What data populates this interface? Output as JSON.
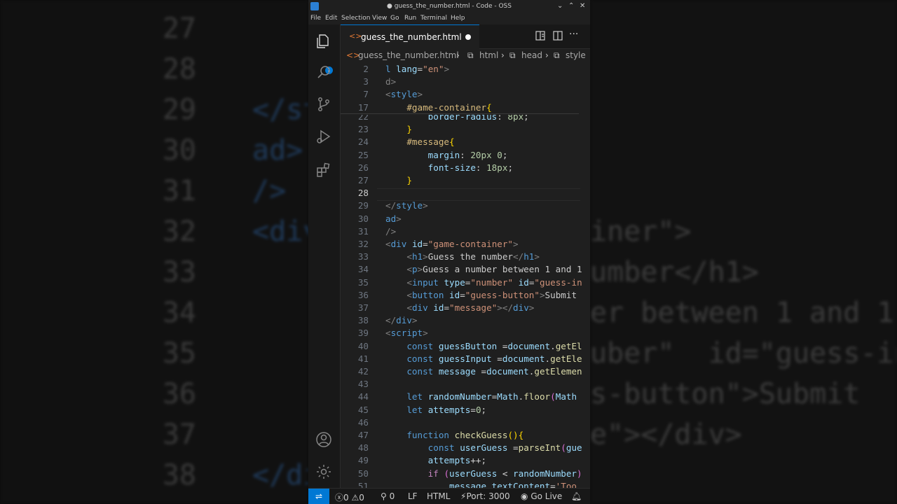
{
  "window": {
    "title": "● guess_the_number.html - Code - OSS",
    "controls": [
      "⌄",
      "⌃",
      "✕"
    ]
  },
  "menu": [
    "File",
    "Edit",
    "Selection",
    "View",
    "Go",
    "Run",
    "Terminal",
    "Help"
  ],
  "activity_bar": {
    "explorer_badge": "1"
  },
  "tab": {
    "label": "guess_the_number.html"
  },
  "breadcrumb": {
    "file": "guess_the_number.html",
    "items": [
      "html",
      "head",
      "style"
    ]
  },
  "editor": {
    "sticky": [
      {
        "ln": "2",
        "code": [
          [
            "l ",
            "tn"
          ],
          [
            "lang",
            "at"
          ],
          [
            "=",
            "tx"
          ],
          [
            "\"en\"",
            "sv"
          ],
          [
            ">",
            "tg"
          ]
        ]
      },
      {
        "ln": "3",
        "code": [
          [
            "d>",
            "tg"
          ]
        ]
      },
      {
        "ln": "7",
        "code": [
          [
            "<",
            "tg"
          ],
          [
            "style",
            "tn"
          ],
          [
            ">",
            "tg"
          ]
        ]
      },
      {
        "ln": "17",
        "code": [
          [
            "    ",
            "tx"
          ],
          [
            "#game-container",
            "sel"
          ],
          [
            "{",
            "br"
          ]
        ]
      }
    ],
    "lines": [
      {
        "ln": "22",
        "code": [
          [
            "        ",
            "tx"
          ],
          [
            "border-radius",
            "pr"
          ],
          [
            ": ",
            "tx"
          ],
          [
            "8px",
            "nu"
          ],
          [
            ";",
            "tx"
          ]
        ]
      },
      {
        "ln": "23",
        "code": [
          [
            "    ",
            "tx"
          ],
          [
            "}",
            "br"
          ]
        ]
      },
      {
        "ln": "24",
        "code": [
          [
            "    ",
            "tx"
          ],
          [
            "#message",
            "sel"
          ],
          [
            "{",
            "br"
          ]
        ]
      },
      {
        "ln": "25",
        "code": [
          [
            "        ",
            "tx"
          ],
          [
            "margin",
            "pr"
          ],
          [
            ": ",
            "tx"
          ],
          [
            "20px 0",
            "nu"
          ],
          [
            ";",
            "tx"
          ]
        ]
      },
      {
        "ln": "26",
        "code": [
          [
            "        ",
            "tx"
          ],
          [
            "font-size",
            "pr"
          ],
          [
            ": ",
            "tx"
          ],
          [
            "18px",
            "nu"
          ],
          [
            ";",
            "tx"
          ]
        ]
      },
      {
        "ln": "27",
        "code": [
          [
            "    ",
            "tx"
          ],
          [
            "}",
            "br"
          ]
        ]
      },
      {
        "ln": "28",
        "code": [],
        "current": true
      },
      {
        "ln": "29",
        "code": [
          [
            "</",
            "tg"
          ],
          [
            "style",
            "tn"
          ],
          [
            ">",
            "tg"
          ]
        ]
      },
      {
        "ln": "30",
        "code": [
          [
            "ad",
            "tn"
          ],
          [
            ">",
            "tg"
          ]
        ]
      },
      {
        "ln": "31",
        "code": [
          [
            "/>",
            "tg"
          ]
        ]
      },
      {
        "ln": "32",
        "code": [
          [
            "<",
            "tg"
          ],
          [
            "div",
            "tn"
          ],
          [
            " ",
            "tx"
          ],
          [
            "id",
            "at"
          ],
          [
            "=",
            "tx"
          ],
          [
            "\"game-container\"",
            "sv"
          ],
          [
            ">",
            "tg"
          ]
        ]
      },
      {
        "ln": "33",
        "code": [
          [
            "    ",
            "tx"
          ],
          [
            "<",
            "tg"
          ],
          [
            "h1",
            "tn"
          ],
          [
            ">",
            "tg"
          ],
          [
            "Guess the number",
            "tx"
          ],
          [
            "</",
            "tg"
          ],
          [
            "h1",
            "tn"
          ],
          [
            ">",
            "tg"
          ]
        ]
      },
      {
        "ln": "34",
        "code": [
          [
            "    ",
            "tx"
          ],
          [
            "<",
            "tg"
          ],
          [
            "p",
            "tn"
          ],
          [
            ">",
            "tg"
          ],
          [
            "Guess a number between 1 and 1",
            "tx"
          ]
        ]
      },
      {
        "ln": "35",
        "code": [
          [
            "    ",
            "tx"
          ],
          [
            "<",
            "tg"
          ],
          [
            "input",
            "tn"
          ],
          [
            " ",
            "tx"
          ],
          [
            "type",
            "at"
          ],
          [
            "=",
            "tx"
          ],
          [
            "\"number\"",
            "sv"
          ],
          [
            " ",
            "tx"
          ],
          [
            "id",
            "at"
          ],
          [
            "=",
            "tx"
          ],
          [
            "\"guess-in",
            "sv"
          ]
        ]
      },
      {
        "ln": "36",
        "code": [
          [
            "    ",
            "tx"
          ],
          [
            "<",
            "tg"
          ],
          [
            "button",
            "tn"
          ],
          [
            " ",
            "tx"
          ],
          [
            "id",
            "at"
          ],
          [
            "=",
            "tx"
          ],
          [
            "\"guess-button\"",
            "sv"
          ],
          [
            ">",
            "tg"
          ],
          [
            "Submit",
            "tx"
          ]
        ]
      },
      {
        "ln": "37",
        "code": [
          [
            "    ",
            "tx"
          ],
          [
            "<",
            "tg"
          ],
          [
            "div",
            "tn"
          ],
          [
            " ",
            "tx"
          ],
          [
            "id",
            "at"
          ],
          [
            "=",
            "tx"
          ],
          [
            "\"message\"",
            "sv"
          ],
          [
            "></",
            "tg"
          ],
          [
            "div",
            "tn"
          ],
          [
            ">",
            "tg"
          ]
        ]
      },
      {
        "ln": "38",
        "code": [
          [
            "</",
            "tg"
          ],
          [
            "div",
            "tn"
          ],
          [
            ">",
            "tg"
          ]
        ]
      },
      {
        "ln": "39",
        "code": [
          [
            "<",
            "tg"
          ],
          [
            "script",
            "tn"
          ],
          [
            ">",
            "tg"
          ]
        ]
      },
      {
        "ln": "40",
        "code": [
          [
            "    ",
            "tx"
          ],
          [
            "const",
            "kw"
          ],
          [
            " ",
            "tx"
          ],
          [
            "guessButton",
            "vr"
          ],
          [
            " =",
            "op"
          ],
          [
            "document",
            "vr"
          ],
          [
            ".",
            "tx"
          ],
          [
            "getEl",
            "fn"
          ]
        ]
      },
      {
        "ln": "41",
        "code": [
          [
            "    ",
            "tx"
          ],
          [
            "const",
            "kw"
          ],
          [
            " ",
            "tx"
          ],
          [
            "guessInput",
            "vr"
          ],
          [
            " =",
            "op"
          ],
          [
            "document",
            "vr"
          ],
          [
            ".",
            "tx"
          ],
          [
            "getEle",
            "fn"
          ]
        ]
      },
      {
        "ln": "42",
        "code": [
          [
            "    ",
            "tx"
          ],
          [
            "const",
            "kw"
          ],
          [
            " ",
            "tx"
          ],
          [
            "message",
            "vr"
          ],
          [
            " =",
            "op"
          ],
          [
            "document",
            "vr"
          ],
          [
            ".",
            "tx"
          ],
          [
            "getElemen",
            "fn"
          ]
        ]
      },
      {
        "ln": "43",
        "code": []
      },
      {
        "ln": "44",
        "code": [
          [
            "    ",
            "tx"
          ],
          [
            "let",
            "kw"
          ],
          [
            " ",
            "tx"
          ],
          [
            "randomNumber",
            "vr"
          ],
          [
            "=",
            "op"
          ],
          [
            "Math",
            "vr"
          ],
          [
            ".",
            "tx"
          ],
          [
            "floor",
            "fn"
          ],
          [
            "(",
            "br2"
          ],
          [
            "Math",
            "vr"
          ]
        ]
      },
      {
        "ln": "45",
        "code": [
          [
            "    ",
            "tx"
          ],
          [
            "let",
            "kw"
          ],
          [
            " ",
            "tx"
          ],
          [
            "attempts",
            "vr"
          ],
          [
            "=",
            "op"
          ],
          [
            "0",
            "nu"
          ],
          [
            ";",
            "tx"
          ]
        ]
      },
      {
        "ln": "46",
        "code": []
      },
      {
        "ln": "47",
        "code": [
          [
            "    ",
            "tx"
          ],
          [
            "function",
            "kw"
          ],
          [
            " ",
            "tx"
          ],
          [
            "checkGuess",
            "fn"
          ],
          [
            "()",
            "br"
          ],
          [
            "{",
            "br"
          ]
        ]
      },
      {
        "ln": "48",
        "code": [
          [
            "        ",
            "tx"
          ],
          [
            "const",
            "kw"
          ],
          [
            " ",
            "tx"
          ],
          [
            "userGuess",
            "vr"
          ],
          [
            " =",
            "op"
          ],
          [
            "parseInt",
            "fn"
          ],
          [
            "(",
            "br2"
          ],
          [
            "gue",
            "vr"
          ]
        ]
      },
      {
        "ln": "49",
        "code": [
          [
            "        ",
            "tx"
          ],
          [
            "attempts",
            "vr"
          ],
          [
            "++",
            "op"
          ],
          [
            ";",
            "tx"
          ]
        ]
      },
      {
        "ln": "50",
        "code": [
          [
            "        ",
            "tx"
          ],
          [
            "if",
            "ck"
          ],
          [
            " ",
            "tx"
          ],
          [
            "(",
            "br2"
          ],
          [
            "userGuess",
            "vr"
          ],
          [
            " < ",
            "op"
          ],
          [
            "randomNumber",
            "vr"
          ],
          [
            ")",
            "br2"
          ]
        ]
      },
      {
        "ln": "51",
        "code": [
          [
            "            ",
            "tx"
          ],
          [
            "message",
            "vr"
          ],
          [
            ".",
            "tx"
          ],
          [
            "textContent",
            "vr"
          ],
          [
            "=",
            "op"
          ],
          [
            "'Too",
            "sv"
          ]
        ]
      }
    ]
  },
  "status": {
    "errors": "0",
    "warnings": "0",
    "ports": "0",
    "eol": "LF",
    "language": "HTML",
    "port": "Port: 3000",
    "go_live": "Go Live"
  },
  "background_zoom": {
    "left_numbers": [
      "27",
      "28",
      "29",
      "30",
      "31",
      "32",
      "33",
      "34",
      "35",
      "36",
      "37",
      "38"
    ],
    "left_text": [
      "",
      "",
      "</st",
      "ad>",
      "/>",
      "<div",
      "",
      "",
      "",
      "",
      "",
      "</di"
    ],
    "right_text": [
      "",
      "",
      "",
      "",
      "",
      "iner\">",
      "umber</h1>",
      "er between 1 and 1",
      "uber\"  id=\"guess-in",
      "s-button\">Submit",
      "e\"></div>",
      ""
    ]
  },
  "colors": {
    "accent": "#0078d4",
    "editor_bg": "#1f1f1f",
    "sidebar_bg": "#181818"
  }
}
